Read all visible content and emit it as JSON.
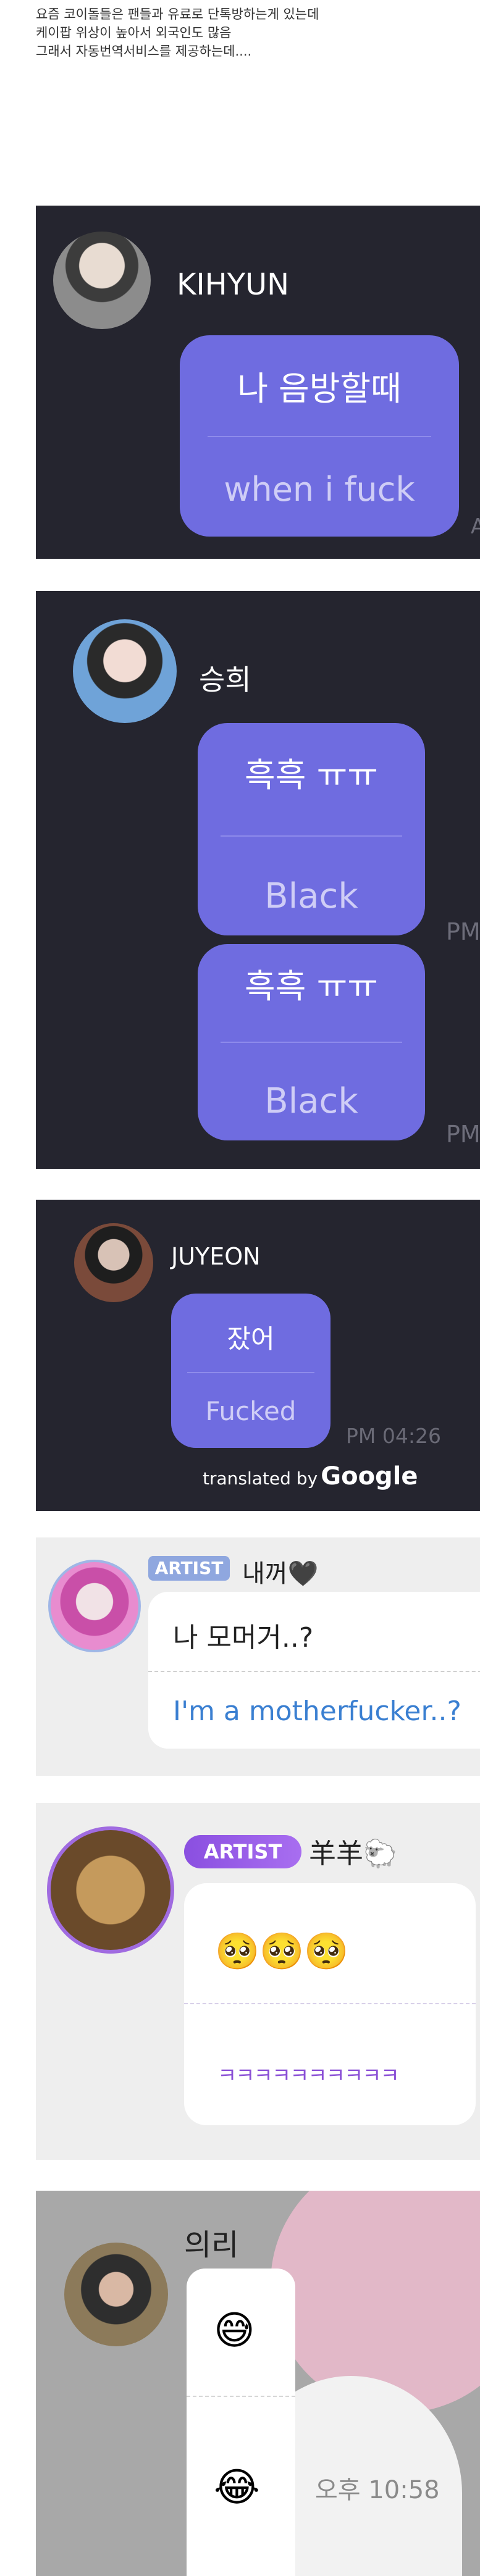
{
  "intro": [
    "요즘 코이돌들은 팬들과 유료로 단톡방하는게 있는데",
    "케이팝 위상이 높아서 외국인도 많음",
    "그래서 자동번역서비스를 제공하는데...."
  ],
  "panel1": {
    "name": "KIHYUN",
    "ko": "나 음방할때",
    "en": "when i fuck",
    "edge": "A"
  },
  "panel2": {
    "name": "승희",
    "ko1": "흑흑 ㅠㅠ",
    "en1": "Black",
    "ko2": "흑흑 ㅠㅠ",
    "en2": "Black",
    "pm": "PM"
  },
  "panel3": {
    "name": "JUYEON",
    "ko": "잤어",
    "en": "Fucked",
    "time": "PM 04:26",
    "translated_prefix": "translated by",
    "translated_brand": "Google"
  },
  "panel4": {
    "badge": "ARTIST",
    "name": "내꺼🖤",
    "ko": "나 모머거..?",
    "en": "I'm a motherfucker..?"
  },
  "panel5": {
    "badge": "ARTIST",
    "name": "羊羊🐑",
    "emoji": "🥺🥺🥺",
    "laugh": "ㅋㅋㅋㅋㅋㅋㅋㅋㅋㅋ"
  },
  "panel6": {
    "name": "의리",
    "emoji1": "😅",
    "emoji2": "😂",
    "time": "오후 10:58"
  }
}
